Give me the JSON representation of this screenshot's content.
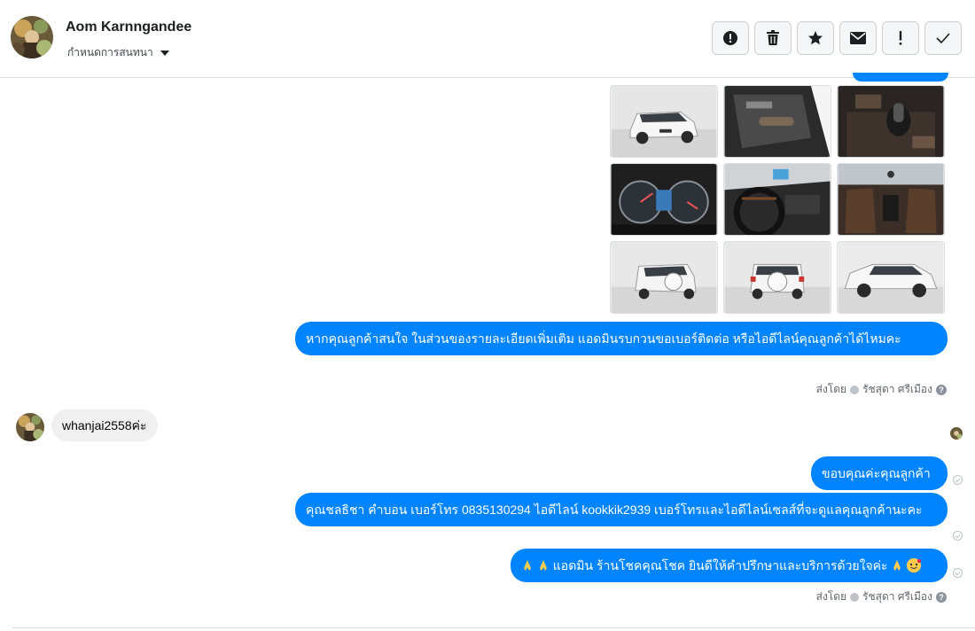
{
  "header": {
    "contact_name": "Aom Karnngandee",
    "assign_label": "กำหนดการสนทนา",
    "actions": [
      "spam-icon",
      "trash-icon",
      "star-icon",
      "envelope-icon",
      "exclamation-icon",
      "check-icon"
    ]
  },
  "messages": {
    "out_1": "หากคุณลูกค้าสนใจ ในส่วนของรายละเอียดเพิ่มเติม แอดมินรบกวนขอเบอร์ติดต่อ หรือไอดีไลน์คุณลูกค้าได้ไหมคะ",
    "in_1": "whanjai2558ค่ะ",
    "out_2": "ขอบคุณค่ะคุณลูกค้า",
    "out_3": "คุณชลธิชา คำบอน เบอร์โทร 0835130294 ไอดีไลน์ kookkik2939   เบอร์โทรและไอดีไลน์เซลส์ที่จะดูแลคุณลูกค้านะคะ",
    "out_4_text": "แอดมิน ร้านโชคคุณโชค ยินดีให้คำปรึกษาและบริการด้วยใจค่ะ"
  },
  "sent_by": {
    "prefix": "ส่งโดย",
    "name": "รัชสุดา ศรีเมือง",
    "help": "?"
  },
  "colors": {
    "bubble_out": "#0084ff",
    "bubble_in": "#f0f0f0",
    "divider": "#dadde1"
  },
  "photos": [
    "car-front-white",
    "door-interior",
    "gear-shift",
    "instrument-cluster",
    "dashboard-steering",
    "cabin-overview",
    "car-rear-left",
    "car-rear",
    "car-side"
  ]
}
